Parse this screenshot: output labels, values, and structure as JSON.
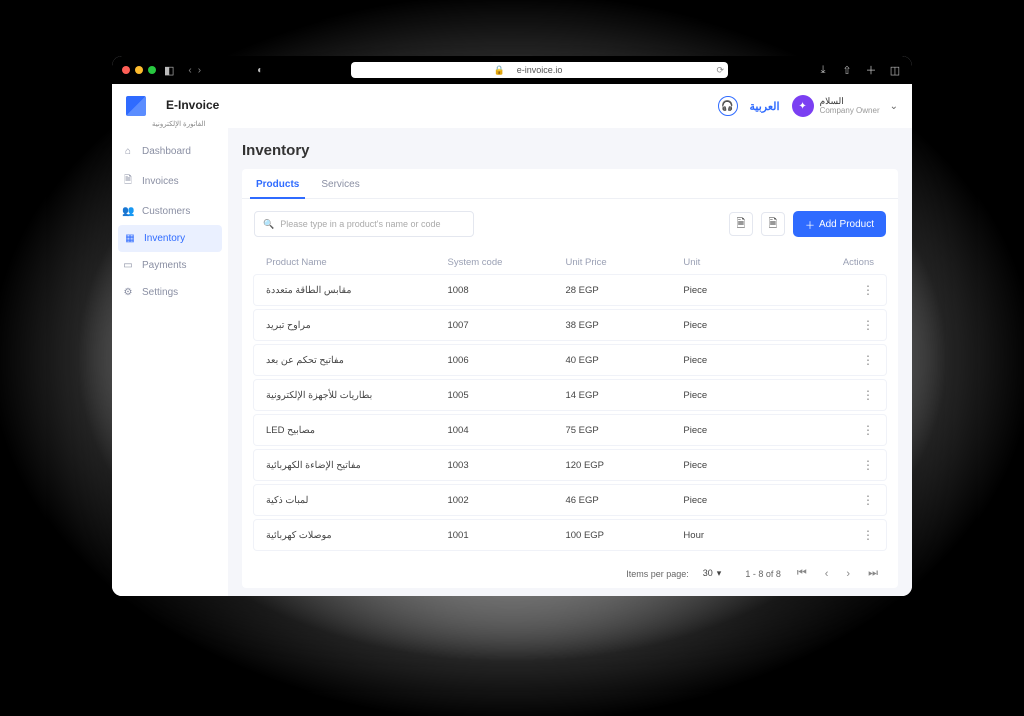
{
  "browser": {
    "url": "e-invoice.io"
  },
  "app": {
    "brand": "E-Invoice",
    "brand_sub": "الفاتورة الإلكترونية",
    "lang": "العربية",
    "user_name": "السلام",
    "user_role": "Company Owner"
  },
  "sidebar": {
    "items": [
      {
        "label": "Dashboard"
      },
      {
        "label": "Invoices"
      },
      {
        "label": "Customers"
      },
      {
        "label": "Inventory"
      },
      {
        "label": "Payments"
      },
      {
        "label": "Settings"
      }
    ]
  },
  "page": {
    "title": "Inventory"
  },
  "tabs": {
    "products": "Products",
    "services": "Services"
  },
  "toolbar": {
    "search_placeholder": "Please type in a product's name or code",
    "add_label": "Add Product"
  },
  "table": {
    "headers": {
      "name": "Product Name",
      "code": "System code",
      "price": "Unit Price",
      "unit": "Unit",
      "actions": "Actions"
    },
    "rows": [
      {
        "name": "مقابس الطاقة متعددة",
        "code": "1008",
        "price": "28 EGP",
        "unit": "Piece"
      },
      {
        "name": "مراوح تبريد",
        "code": "1007",
        "price": "38 EGP",
        "unit": "Piece"
      },
      {
        "name": "مفاتيح تحكم عن بعد",
        "code": "1006",
        "price": "40 EGP",
        "unit": "Piece"
      },
      {
        "name": "بطاريات للأجهزة الإلكترونية",
        "code": "1005",
        "price": "14 EGP",
        "unit": "Piece"
      },
      {
        "name": "LED مصابيح",
        "code": "1004",
        "price": "75 EGP",
        "unit": "Piece"
      },
      {
        "name": "مفاتيح الإضاءة الكهربائية",
        "code": "1003",
        "price": "120 EGP",
        "unit": "Piece"
      },
      {
        "name": "لمبات ذكية",
        "code": "1002",
        "price": "46 EGP",
        "unit": "Piece"
      },
      {
        "name": "موصلات كهربائية",
        "code": "1001",
        "price": "100 EGP",
        "unit": "Hour"
      }
    ]
  },
  "pager": {
    "items_per_page_label": "Items per page:",
    "per_page": "30",
    "range": "1 - 8 of 8"
  }
}
